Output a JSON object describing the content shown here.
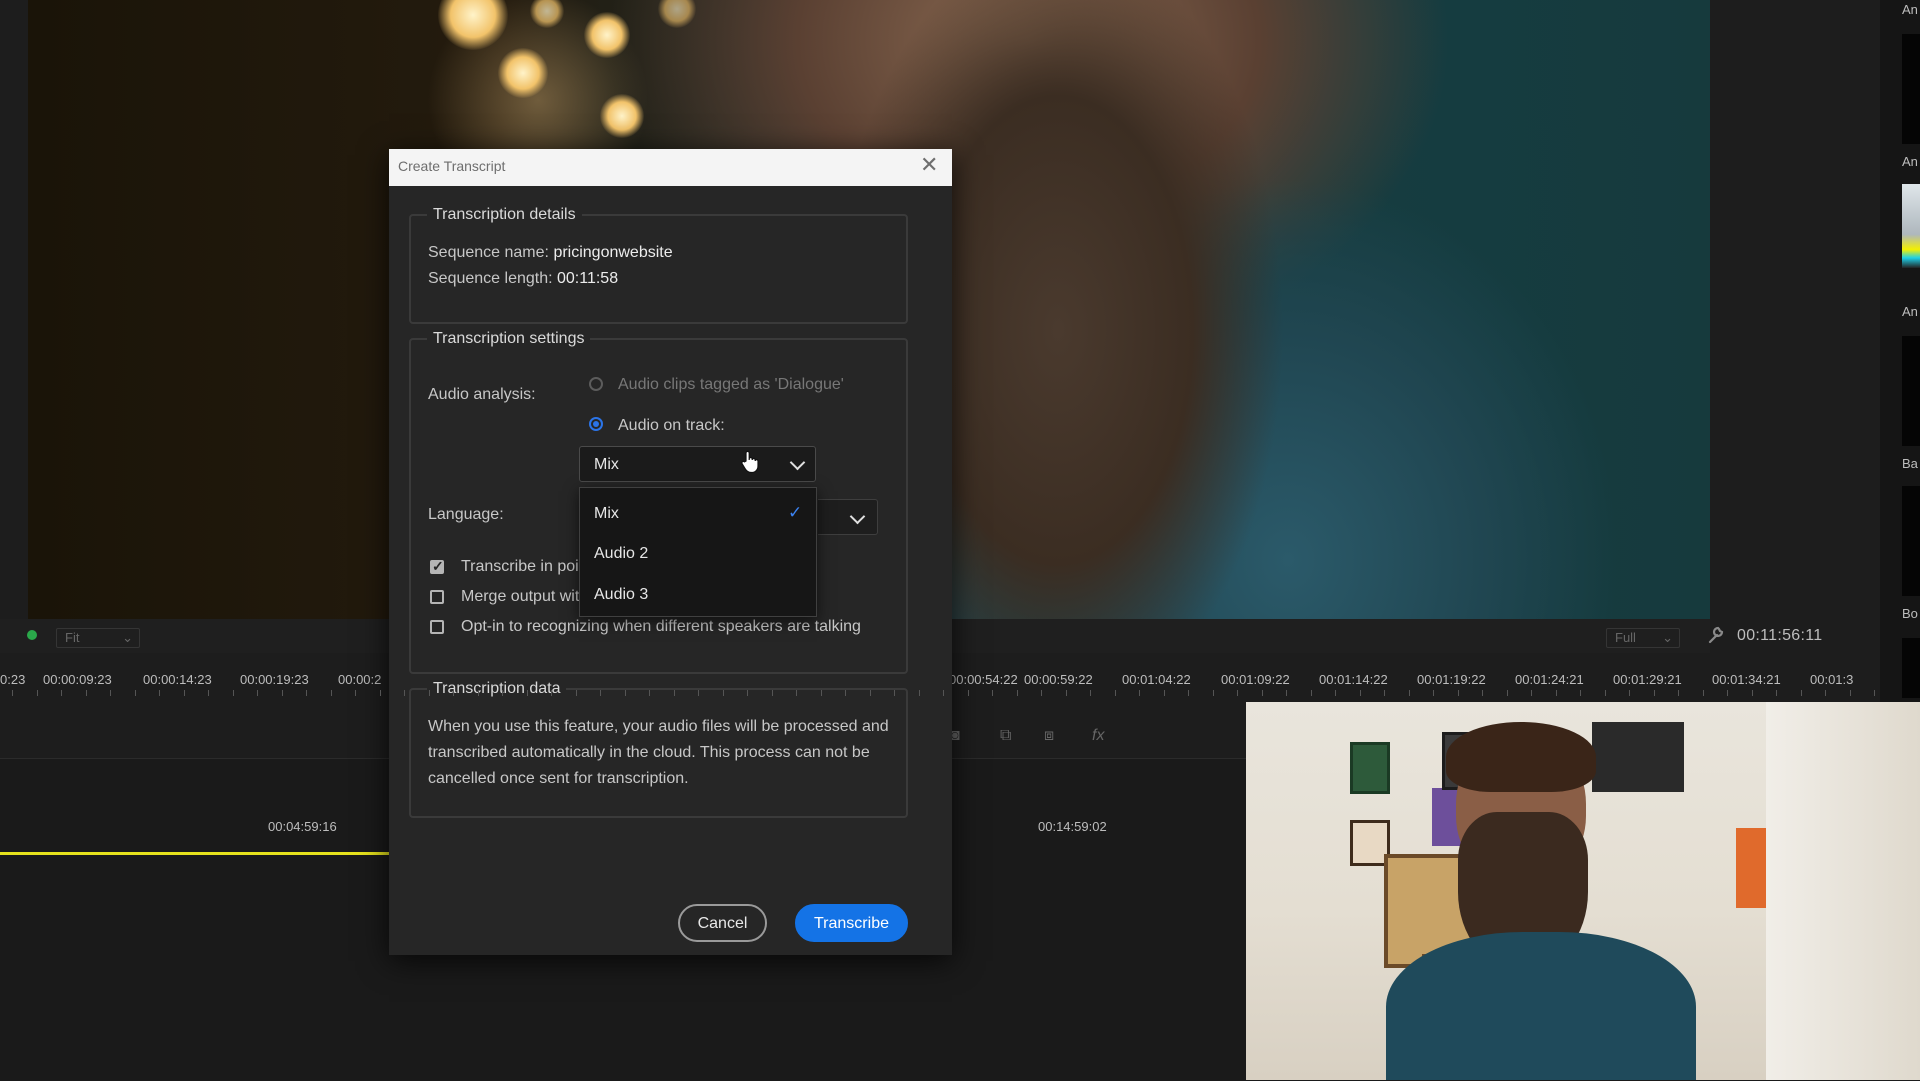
{
  "timecode": "00:11:56:11",
  "monitor": {
    "fit_label": "Fit",
    "quality_label": "Full"
  },
  "ruler": {
    "labels": [
      "0:23",
      "00:00:09:23",
      "00:00:14:23",
      "00:00:19:23",
      "00:00:2",
      "00:00:54:22",
      "00:00:59:22",
      "00:01:04:22",
      "00:01:09:22",
      "00:01:14:22",
      "00:01:19:22",
      "00:01:24:21",
      "00:01:29:21",
      "00:01:34:21",
      "00:01:3"
    ]
  },
  "timeline": {
    "timecode_left": "00:04:59:16",
    "timecode_right": "00:14:59:02"
  },
  "right_panel": {
    "labels": [
      "An",
      "An",
      "An",
      "Ba",
      "Bo"
    ]
  },
  "dialog": {
    "title": "Create Transcript",
    "details": {
      "legend": "Transcription details",
      "sequence_name_label": "Sequence name:",
      "sequence_name": "pricingonwebsite",
      "sequence_length_label": "Sequence length:",
      "sequence_length": "00:11:58"
    },
    "settings": {
      "legend": "Transcription settings",
      "audio_analysis_label": "Audio analysis:",
      "option_dialogue": "Audio clips tagged as 'Dialogue'",
      "option_track": "Audio on track:",
      "track_selected": "Mix",
      "track_options": [
        "Mix",
        "Audio 2",
        "Audio 3"
      ],
      "language_label": "Language:",
      "checkbox_points": "Transcribe in poir",
      "checkbox_merge": "Merge output wit",
      "checkbox_speakers": "Opt-in to recognizing when different speakers are talking"
    },
    "data_section": {
      "legend": "Transcription data",
      "line1": "When you use this feature, your audio files will be processed and",
      "line2": "transcribed automatically in the cloud. This process can not be",
      "line3": "cancelled once sent for transcription."
    },
    "cancel_label": "Cancel",
    "transcribe_label": "Transcribe"
  },
  "colors": {
    "accent": "#1473e6",
    "playhead_bar": "#e6e21d",
    "check": "#3b82f0"
  },
  "state": {
    "audio_analysis": "Audio on track",
    "transcribe_in_points_checked": true,
    "merge_output_checked": false,
    "speakers_checked": false
  }
}
